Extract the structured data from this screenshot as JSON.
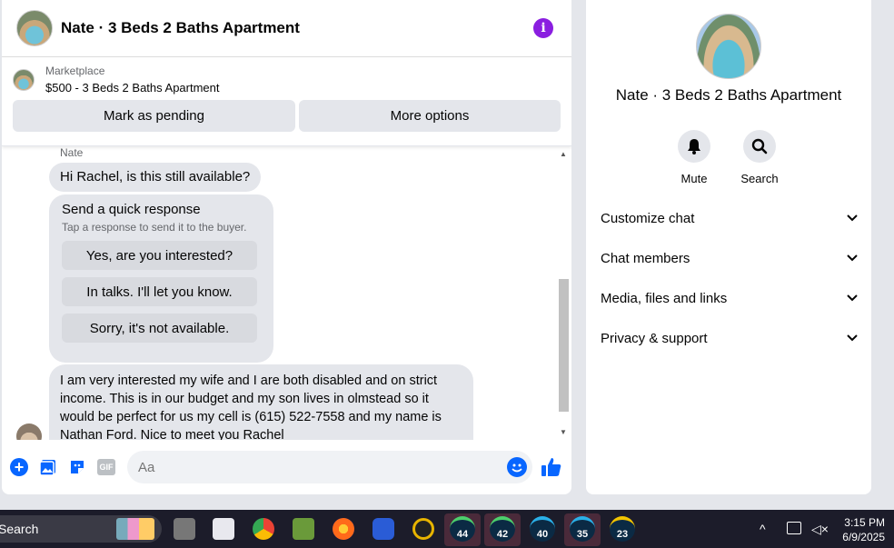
{
  "chat": {
    "title": "Nate · 3 Beds 2 Baths Apartment",
    "marketplace_label": "Marketplace",
    "listing": "$500 - 3 Beds 2 Baths Apartment",
    "mark_pending": "Mark as pending",
    "more_options": "More options",
    "sender": "Nate",
    "message1": "Hi Rachel, is this still available?",
    "quick_title": "Send a quick response",
    "quick_subtitle": "Tap a response to send it to the buyer.",
    "quick_responses": [
      "Yes, are you interested?",
      "In talks. I'll let you know.",
      "Sorry, it's not available."
    ],
    "message2": "I am very interested my wife and I are both disabled and on strict income. This is in our budget and my son lives in olmstead so it would be perfect for us my cell is (615) 522-7558 and my name is Nathan Ford. Nice to meet you Rachel",
    "input_placeholder": "Aa",
    "gif_label": "GIF"
  },
  "info": {
    "name": "Nate · 3 Beds 2 Baths Apartment",
    "mute": "Mute",
    "search": "Search",
    "sections": [
      "Customize chat",
      "Chat members",
      "Media, files and links",
      "Privacy & support"
    ]
  },
  "taskbar": {
    "search": "Search",
    "badges": [
      "44",
      "42",
      "40",
      "35",
      "23"
    ],
    "time": "3:15 PM",
    "date": "6/9/2025"
  },
  "colors": {
    "accent": "#0866ff",
    "info_purple": "#8a1ee0"
  }
}
